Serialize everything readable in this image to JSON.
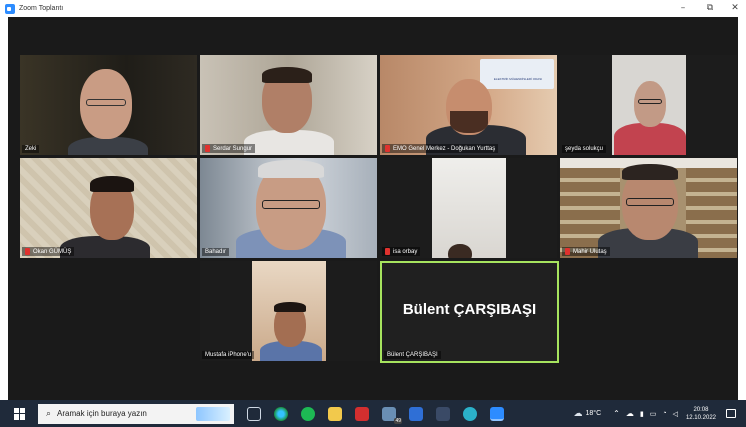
{
  "window": {
    "title": "Zoom Toplantı",
    "minimize_glyph": "–",
    "maximize_glyph": "⧉",
    "close_glyph": "✕"
  },
  "participants": [
    {
      "name": "Zeki",
      "muted": false
    },
    {
      "name": "Serdar Sungur",
      "muted": true
    },
    {
      "name": "EMO Genel Merkez - Doğukan Yurttaş",
      "muted": true
    },
    {
      "name": "şeyda solukçu",
      "muted": false
    },
    {
      "name": "Okan GÜMÜŞ",
      "muted": true
    },
    {
      "name": "Bahadır",
      "muted": false
    },
    {
      "name": "isa orbay",
      "muted": true
    },
    {
      "name": "Mahir Ulutaş",
      "muted": true
    },
    {
      "name": "Mustafa iPhone'u",
      "muted": false
    },
    {
      "name": "Bülent ÇARŞIBAŞI",
      "muted": false,
      "active_speaker": true
    }
  ],
  "active_speaker": {
    "display_name": "Bülent ÇARŞIBAŞI",
    "label": "Bülent ÇARŞIBAŞI"
  },
  "background_sign_text": "ELEKTRİK MÜHENDİSLERİ ODASI",
  "taskbar": {
    "search_placeholder": "Aramak için buraya yazın",
    "weather": "18°C",
    "mail_badge": "49",
    "time": "20:08",
    "date": "12.10.2022"
  }
}
